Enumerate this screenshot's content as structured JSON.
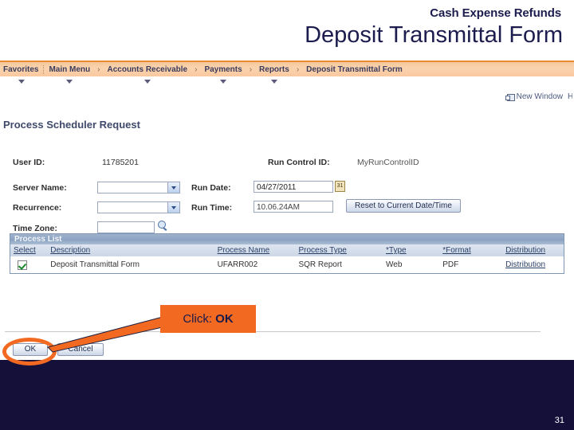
{
  "slide": {
    "kicker": "Cash Expense Refunds",
    "title": "Deposit Transmittal Form",
    "page_number": "31",
    "title_color": "#1c1c4e",
    "band_color": "#15103a",
    "accent_color": "#f26a21"
  },
  "breadcrumb": {
    "favorites": "Favorites",
    "separator": "›",
    "items": [
      {
        "label": "Main Menu",
        "has_caret": true
      },
      {
        "label": "Accounts Receivable",
        "has_caret": true
      },
      {
        "label": "Payments",
        "has_caret": true
      },
      {
        "label": "Reports",
        "has_caret": true
      },
      {
        "label": "Deposit Transmittal Form",
        "has_caret": false
      }
    ]
  },
  "toolbar": {
    "new_window": "New Window",
    "new_window_icon": "new-window-icon",
    "trailing": "H"
  },
  "page": {
    "heading": "Process Scheduler Request"
  },
  "form": {
    "user_id_label": "User ID:",
    "user_id_value": "11785201",
    "run_control_label": "Run Control ID:",
    "run_control_value": "MyRunControlID",
    "server_name_label": "Server Name:",
    "server_name_value": "",
    "recurrence_label": "Recurrence:",
    "recurrence_value": "",
    "time_zone_label": "Time Zone:",
    "time_zone_value": "",
    "time_zone_lookup_icon": "magnifier-icon",
    "run_date_label": "Run Date:",
    "run_date_value": "04/27/2011",
    "calendar_icon": "calendar-icon",
    "calendar_icon_glyph": "31",
    "run_time_label": "Run Time:",
    "run_time_value": "10.06.24AM",
    "reset_button": "Reset to Current Date/Time",
    "dropdown_icon": "chevron-down-icon"
  },
  "process_list": {
    "title": "Process List",
    "columns": [
      "Select",
      "Description",
      "Process Name",
      "Process Type",
      "*Type",
      "*Format",
      "Distribution"
    ],
    "rows": [
      {
        "selected": true,
        "description": "Deposit Transmittal Form",
        "process_name": "UFARR002",
        "process_type": "SQR Report",
        "type": "Web",
        "format": "PDF",
        "distribution": "Distribution"
      }
    ]
  },
  "footer": {
    "ok_label": "OK",
    "cancel_label": "Cancel"
  },
  "callout": {
    "prefix": "Click: ",
    "emphasis": "OK"
  }
}
